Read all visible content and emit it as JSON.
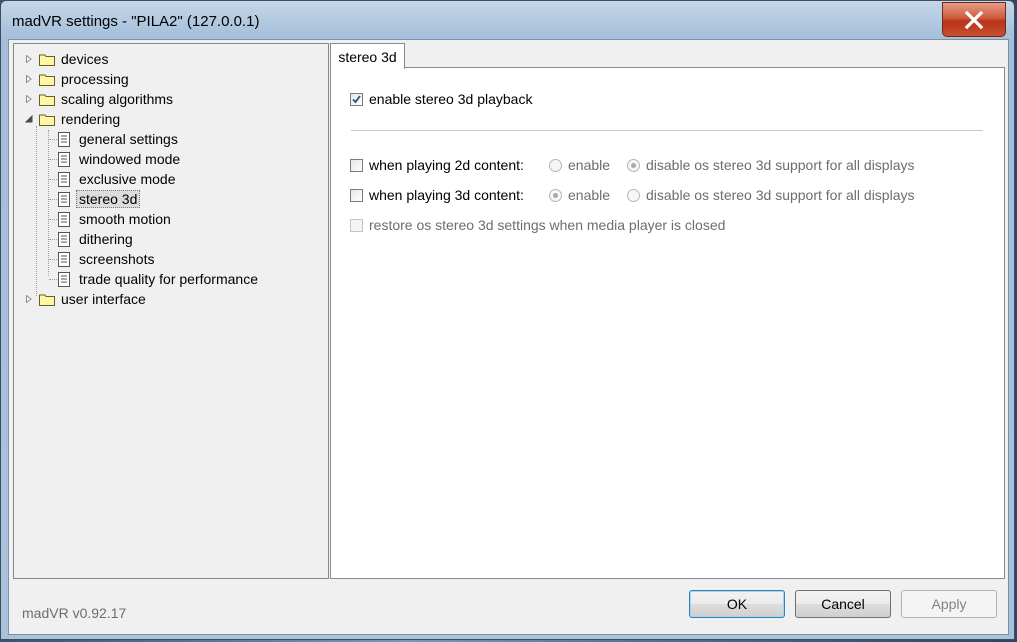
{
  "window": {
    "title": "madVR settings - \"PILA2\" (127.0.0.1)"
  },
  "tree": {
    "items": [
      {
        "label": "devices",
        "type": "folder",
        "expander": "collapsed"
      },
      {
        "label": "processing",
        "type": "folder",
        "expander": "collapsed"
      },
      {
        "label": "scaling algorithms",
        "type": "folder",
        "expander": "collapsed"
      },
      {
        "label": "rendering",
        "type": "folder",
        "expander": "expanded"
      },
      {
        "label": "general settings",
        "type": "page"
      },
      {
        "label": "windowed mode",
        "type": "page"
      },
      {
        "label": "exclusive mode",
        "type": "page"
      },
      {
        "label": "stereo 3d",
        "type": "page",
        "selected": true
      },
      {
        "label": "smooth motion",
        "type": "page"
      },
      {
        "label": "dithering",
        "type": "page"
      },
      {
        "label": "screenshots",
        "type": "page"
      },
      {
        "label": "trade quality for performance",
        "type": "page"
      },
      {
        "label": "user interface",
        "type": "folder",
        "expander": "collapsed"
      }
    ]
  },
  "tab": {
    "label": "stereo 3d"
  },
  "settings": {
    "enable_stereo": {
      "label": "enable stereo 3d playback",
      "checked": true
    },
    "playing_2d": {
      "label": "when playing 2d content:",
      "checked": false,
      "opt_enable": "enable",
      "opt_disable": "disable os stereo 3d support for all displays",
      "selected": "disable"
    },
    "playing_3d": {
      "label": "when playing 3d content:",
      "checked": false,
      "opt_enable": "enable",
      "opt_disable": "disable os stereo 3d support for all displays",
      "selected": "enable"
    },
    "restore": {
      "label": "restore os stereo 3d settings when media player is closed",
      "checked": false,
      "disabled": true
    }
  },
  "footer": {
    "version": "madVR v0.92.17",
    "ok_label": "OK",
    "cancel_label": "Cancel",
    "apply_label": "Apply"
  },
  "icons": {
    "close": "close-x-icon",
    "folder": "folder-icon",
    "page": "page-icon",
    "expander_collapsed": "triangle-right-icon",
    "expander_expanded": "triangle-down-icon",
    "check": "checkmark-icon"
  },
  "colors": {
    "close_button": "#c7452a",
    "selection": "#dcdcdc",
    "default_button_border": "#3c7fb1"
  }
}
